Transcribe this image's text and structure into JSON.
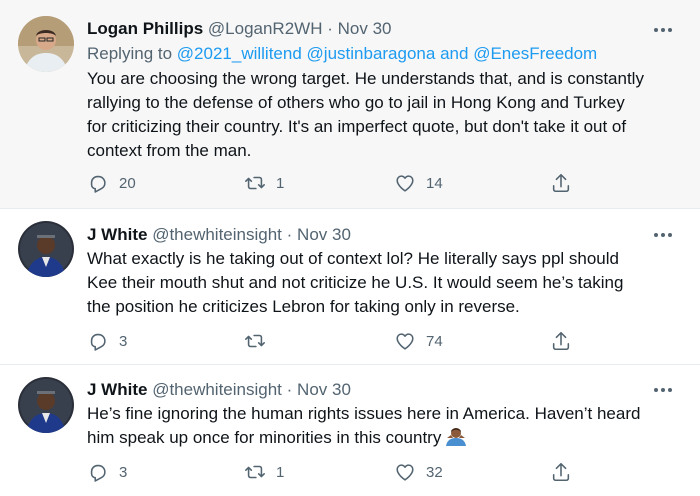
{
  "tweets": [
    {
      "name": "Logan Phillips",
      "handle": "@LoganR2WH",
      "sep": "·",
      "date": "Nov 30",
      "reply_prefix": "Replying to",
      "reply_user1": "@2021_willitend",
      "reply_user2": "@justinbaragona",
      "reply_and": "and",
      "reply_user3": "@EnesFreedom",
      "lines": [
        "You are choosing the wrong target. He understands that, and is constantly",
        "rallying to the defense of others who go to jail in Hong Kong and Turkey",
        "for criticizing their country. It's an imperfect quote, but don't take it out of",
        "context from the man."
      ],
      "replies": "20",
      "retweets": "1",
      "likes": "14"
    },
    {
      "name": "J White",
      "handle": "@thewhiteinsight",
      "sep": "·",
      "date": "Nov 30",
      "lines": [
        "What exactly is he taking out of context lol? He literally says ppl should",
        "Kee their mouth shut and not criticize he U.S. It would seem he’s taking",
        "the position he criticizes Lebron for taking only in reverse."
      ],
      "replies": "3",
      "retweets": "",
      "likes": "74"
    },
    {
      "name": "J White",
      "handle": "@thewhiteinsight",
      "sep": "·",
      "date": "Nov 30",
      "lines": [
        "He’s fine ignoring the human rights issues here in America. Haven’t heard",
        "him speak up once for minorities in this country"
      ],
      "replies": "3",
      "retweets": "1",
      "likes": "32"
    }
  ],
  "icons": {
    "reply": "reply-icon",
    "retweet": "retweet-icon",
    "like": "heart-icon",
    "share": "share-icon",
    "more": "more-icon",
    "emoji": "person-shrugging-emoji"
  },
  "colors": {
    "link": "#1d9bf0",
    "secondary": "#536471",
    "text": "#0f1419",
    "highlight_bg": "#f7f7f7"
  }
}
